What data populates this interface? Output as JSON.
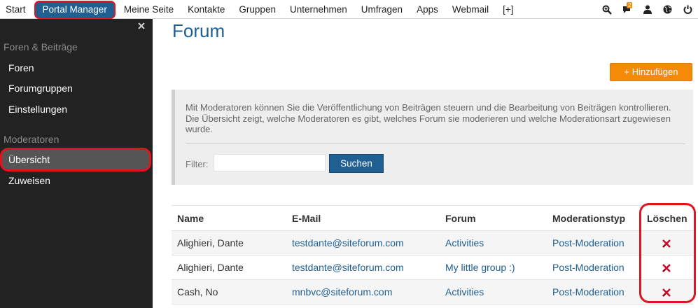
{
  "nav": {
    "items": [
      "Start",
      "Portal Manager",
      "Meine Seite",
      "Kontakte",
      "Gruppen",
      "Unternehmen",
      "Umfragen",
      "Apps",
      "Webmail",
      "[+]"
    ],
    "active_index": 1,
    "icons": [
      "search-plus-icon",
      "comments-icon",
      "user-icon",
      "globe-icon",
      "power-icon"
    ],
    "notification_count": "2"
  },
  "sidebar": {
    "close_icon": "close-icon",
    "sections": [
      {
        "title": "Foren & Beiträge",
        "items": [
          "Foren",
          "Forumgruppen",
          "Einstellungen"
        ]
      },
      {
        "title": "Moderatoren",
        "items": [
          "Übersicht",
          "Zuweisen"
        ]
      }
    ],
    "selected": "Übersicht"
  },
  "page": {
    "title": "Forum",
    "add_button": "+ Hinzufügen"
  },
  "info": {
    "text": "Mit Moderatoren können Sie die Veröffentlichung von Beiträgen steuern und die Bearbeitung von Beiträgen kontrollieren. Die Übersicht zeigt, welche Moderatoren es gibt, welches Forum sie moderieren und welche Moderationsart zugewiesen wurde.",
    "filter_label": "Filter:",
    "filter_value": "",
    "search_button": "Suchen"
  },
  "table": {
    "headers": [
      "Name",
      "E-Mail",
      "Forum",
      "Moderationstyp",
      "Löschen"
    ],
    "rows": [
      {
        "name": "Alighieri, Dante",
        "email": "testdante@siteforum.com",
        "forum": "Activities",
        "type": "Post-Moderation",
        "delete_icon": "delete-icon"
      },
      {
        "name": "Alighieri, Dante",
        "email": "testdante@siteforum.com",
        "forum": "My little group :)",
        "type": "Post-Moderation",
        "delete_icon": "delete-icon"
      },
      {
        "name": "Cash, No",
        "email": "mnbvc@siteforum.com",
        "forum": "Activities",
        "type": "Post-Moderation",
        "delete_icon": "delete-icon"
      }
    ]
  },
  "colors": {
    "brand_blue": "#1f5f91",
    "accent_orange": "#f58a07",
    "highlight_red": "#e0141c",
    "delete_red": "#c8102e",
    "sidebar_bg": "#222222"
  }
}
